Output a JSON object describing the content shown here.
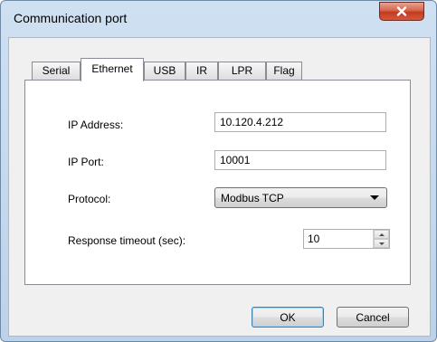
{
  "window": {
    "title": "Communication port"
  },
  "tabs": [
    {
      "label": "Serial"
    },
    {
      "label": "Ethernet",
      "active": true
    },
    {
      "label": "USB"
    },
    {
      "label": "IR"
    },
    {
      "label": "LPR"
    },
    {
      "label": "Flag"
    }
  ],
  "ethernet": {
    "ip_address_label": "IP Address:",
    "ip_address_value": "10.120.4.212",
    "ip_port_label": "IP Port:",
    "ip_port_value": "10001",
    "protocol_label": "Protocol:",
    "protocol_value": "Modbus TCP",
    "timeout_label": "Response timeout (sec):",
    "timeout_value": "10"
  },
  "buttons": {
    "ok": "OK",
    "cancel": "Cancel"
  },
  "colors": {
    "close_button": "#c43a1f",
    "title_bar": "#cfe0f2",
    "default_button_border": "#3c7fb1"
  },
  "icons": {
    "close": "close-icon",
    "dropdown": "chevron-down-icon",
    "spin_up": "spin-up-icon",
    "spin_down": "spin-down-icon"
  }
}
